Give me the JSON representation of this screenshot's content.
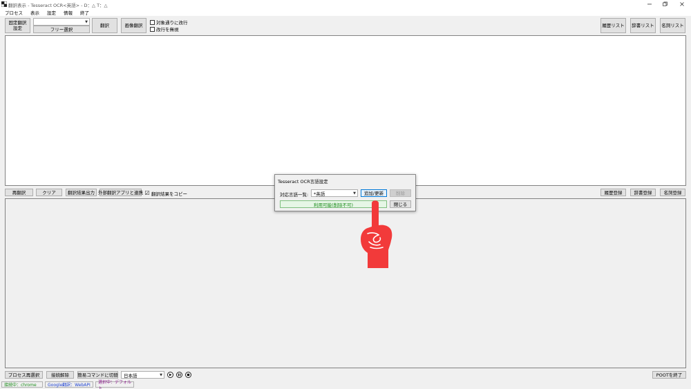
{
  "window": {
    "title": "翻訳表示 - Tesseract OCR<英語> - D：△ T：△"
  },
  "menu": [
    "プロセス",
    "表示",
    "設定",
    "情報",
    "終了"
  ],
  "toolbar": {
    "fixed_translation_line1": "固定翻訳",
    "fixed_translation_line2": "設定",
    "free_select": "フリー選択",
    "translate": "翻訳",
    "image_translate": "画像翻訳",
    "check_linebreak": "対象通りに改行",
    "check_ignore_linebreak": "改行を無視",
    "history_list": "履歴リスト",
    "dictionary_list": "辞書リスト",
    "name_list": "名詞リスト"
  },
  "midbar": {
    "retranslate": "再翻訳",
    "clear": "クリア",
    "output_result": "翻訳結果出力",
    "external_app": "外部翻訳アプリと連携",
    "copy_result": "翻訳結果をコピー",
    "copy_checked": "☑",
    "history_register": "履歴登録",
    "dictionary_register": "辞書登録",
    "name_register": "名詞登録"
  },
  "bottombar": {
    "reselect_process": "プロセス再選択",
    "disconnect": "接続解除",
    "switch_simple_command": "簡易コマンドに切替",
    "language_value": "日本語",
    "exit_button": "POOTを終了"
  },
  "status": {
    "connected": "接続中：chrome",
    "google": "Google翻訳：WebAPI",
    "selected": "選択中：デフォルト",
    "connected_color": "#1a8a1a",
    "google_color": "#1a3fd0",
    "selected_color": "#8a1a8a"
  },
  "dialog": {
    "title": "Tesseract OCR言語設定",
    "languages_label": "対応言語一覧:",
    "language_selected": "*英語",
    "add_update": "追加/更新",
    "delete": "削除",
    "status_text": "利用可能(削除不可)",
    "close": "閉じる",
    "status_color": "#1a8a1a"
  },
  "icons": {
    "app": "app-icon",
    "hand": "pointing-hand-icon",
    "play": "play-icon",
    "pause": "pause-icon",
    "stop": "stop-icon"
  }
}
